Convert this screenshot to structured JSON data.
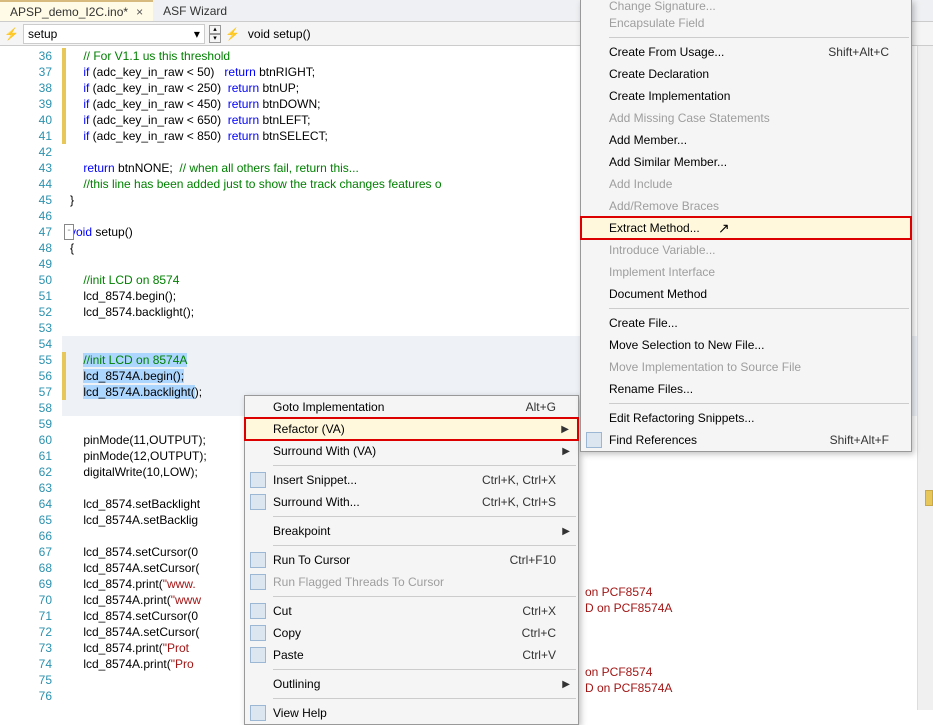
{
  "tabs": [
    {
      "label": "APSP_demo_I2C.ino*",
      "active": true
    },
    {
      "label": "ASF Wizard",
      "active": false
    }
  ],
  "toolbar": {
    "scope": "setup",
    "func": "void setup()"
  },
  "lines": {
    "start": 36,
    "rows": [
      {
        "n": 36,
        "html": "    <span class='cm'>// For V1.1 us this threshold</span>",
        "changed": true
      },
      {
        "n": 37,
        "html": "    <span class='kw'>if</span> (adc_key_in_raw &lt; 50)   <span class='kw'>return</span> btnRIGHT;",
        "changed": true
      },
      {
        "n": 38,
        "html": "    <span class='kw'>if</span> (adc_key_in_raw &lt; 250)  <span class='kw'>return</span> btnUP;",
        "changed": true
      },
      {
        "n": 39,
        "html": "    <span class='kw'>if</span> (adc_key_in_raw &lt; 450)  <span class='kw'>return</span> btnDOWN;",
        "changed": true
      },
      {
        "n": 40,
        "html": "    <span class='kw'>if</span> (adc_key_in_raw &lt; 650)  <span class='kw'>return</span> btnLEFT;",
        "changed": true
      },
      {
        "n": 41,
        "html": "    <span class='kw'>if</span> (adc_key_in_raw &lt; 850)  <span class='kw'>return</span> btnSELECT;",
        "changed": true
      },
      {
        "n": 42,
        "html": ""
      },
      {
        "n": 43,
        "html": "    <span class='kw'>return</span> btnNONE;  <span class='cm'>// when all others fail, return this...</span>"
      },
      {
        "n": 44,
        "html": "    <span class='cm'>//this line has been added just to show the track changes features o</span>"
      },
      {
        "n": 45,
        "html": "}"
      },
      {
        "n": 46,
        "html": ""
      },
      {
        "n": 47,
        "html": "<span class='kw'>void</span> setup()",
        "outline": true
      },
      {
        "n": 48,
        "html": "{"
      },
      {
        "n": 49,
        "html": ""
      },
      {
        "n": 50,
        "html": "    <span class='cm'>//init LCD on 8574</span>"
      },
      {
        "n": 51,
        "html": "    lcd_8574.begin();"
      },
      {
        "n": 52,
        "html": "    lcd_8574.backlight();"
      },
      {
        "n": 53,
        "html": ""
      },
      {
        "n": 54,
        "html": "",
        "hl": true
      },
      {
        "n": 55,
        "html": "    <span class='sel'><span class='cm'>//init LCD on 8574A</span></span>",
        "hl": true,
        "changed": true
      },
      {
        "n": 56,
        "html": "    <span class='sel'>lcd_8574A.begin();</span>",
        "hl": true,
        "changed": true
      },
      {
        "n": 57,
        "html": "    <span class='sel'>lcd_8574A.backlight(</span>);",
        "hl": true,
        "changed": true
      },
      {
        "n": 58,
        "html": "",
        "hl": true
      },
      {
        "n": 59,
        "html": ""
      },
      {
        "n": 60,
        "html": "    pinMode(11,OUTPUT);"
      },
      {
        "n": 61,
        "html": "    pinMode(12,OUTPUT);"
      },
      {
        "n": 62,
        "html": "    digitalWrite(10,LOW);"
      },
      {
        "n": 63,
        "html": ""
      },
      {
        "n": 64,
        "html": "    lcd_8574.setBacklight"
      },
      {
        "n": 65,
        "html": "    lcd_8574A.setBacklig"
      },
      {
        "n": 66,
        "html": ""
      },
      {
        "n": 67,
        "html": "    lcd_8574.setCursor(0"
      },
      {
        "n": 68,
        "html": "    lcd_8574A.setCursor("
      },
      {
        "n": 69,
        "html": "    lcd_8574.print(<span class='st'>\"www.</span>"
      },
      {
        "n": 70,
        "html": "    lcd_8574A.print(<span class='st'>\"www</span>"
      },
      {
        "n": 71,
        "html": "    lcd_8574.setCursor(0"
      },
      {
        "n": 72,
        "html": "    lcd_8574A.setCursor("
      },
      {
        "n": 73,
        "html": "    lcd_8574.print(<span class='st'>\"Prot</span>"
      },
      {
        "n": 74,
        "html": "    lcd_8574A.print(<span class='st'>\"Pro</span>"
      },
      {
        "n": 75,
        "html": ""
      },
      {
        "n": 76,
        "html": ""
      }
    ]
  },
  "peek_text": {
    "l1": " on PCF8574",
    "l2": "D on PCF8574A",
    "l3": " on PCF8574",
    "l4": "D on PCF8574A"
  },
  "menu1": [
    {
      "label": "Goto Implementation",
      "shortcut": "Alt+G"
    },
    {
      "label": "Refactor (VA)",
      "arrow": true,
      "highlight": true,
      "redbox": true
    },
    {
      "label": "Surround With (VA)",
      "arrow": true
    },
    {
      "sep": true
    },
    {
      "label": "Insert Snippet...",
      "shortcut": "Ctrl+K, Ctrl+X",
      "icon": "snippet-icon"
    },
    {
      "label": "Surround With...",
      "shortcut": "Ctrl+K, Ctrl+S",
      "icon": "surround-icon"
    },
    {
      "sep": true
    },
    {
      "label": "Breakpoint",
      "arrow": true
    },
    {
      "sep": true
    },
    {
      "label": "Run To Cursor",
      "shortcut": "Ctrl+F10",
      "icon": "run-cursor-icon"
    },
    {
      "label": "Run Flagged Threads To Cursor",
      "disabled": true,
      "icon": "run-flagged-icon"
    },
    {
      "sep": true
    },
    {
      "label": "Cut",
      "shortcut": "Ctrl+X",
      "icon": "cut-icon"
    },
    {
      "label": "Copy",
      "shortcut": "Ctrl+C",
      "icon": "copy-icon"
    },
    {
      "label": "Paste",
      "shortcut": "Ctrl+V",
      "icon": "paste-icon"
    },
    {
      "sep": true
    },
    {
      "label": "Outlining",
      "arrow": true
    },
    {
      "sep": true
    },
    {
      "label": "View Help",
      "icon": "help-icon"
    }
  ],
  "menu2": [
    {
      "label": "Change Signature...",
      "disabled": true,
      "cut": true
    },
    {
      "label": "Encapsulate Field",
      "disabled": true
    },
    {
      "sep": true
    },
    {
      "label": "Create From Usage...",
      "shortcut": "Shift+Alt+C"
    },
    {
      "label": "Create Declaration"
    },
    {
      "label": "Create Implementation"
    },
    {
      "label": "Add Missing Case Statements",
      "disabled": true
    },
    {
      "label": "Add Member..."
    },
    {
      "label": "Add Similar Member..."
    },
    {
      "label": "Add Include",
      "disabled": true
    },
    {
      "label": "Add/Remove Braces",
      "disabled": true
    },
    {
      "label": "Extract Method...",
      "highlight": true,
      "redbox": true,
      "cursor": true
    },
    {
      "label": "Introduce Variable...",
      "disabled": true
    },
    {
      "label": "Implement Interface",
      "disabled": true
    },
    {
      "label": "Document Method"
    },
    {
      "sep": true
    },
    {
      "label": "Create File..."
    },
    {
      "label": "Move Selection to New File..."
    },
    {
      "label": "Move Implementation to Source File",
      "disabled": true
    },
    {
      "label": "Rename Files..."
    },
    {
      "sep": true
    },
    {
      "label": "Edit Refactoring Snippets..."
    },
    {
      "label": "Find References",
      "shortcut": "Shift+Alt+F",
      "icon": "find-ref-icon"
    }
  ]
}
